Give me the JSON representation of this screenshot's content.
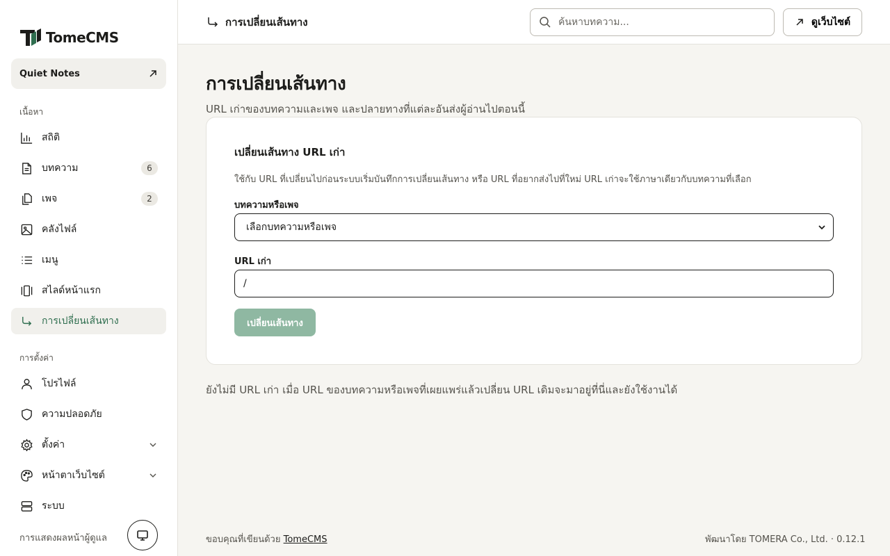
{
  "brand": {
    "name": "TomeCMS",
    "accent": "#2f6e4f",
    "button_disabled": "#8fb8a2"
  },
  "site": {
    "name": "Quiet Notes"
  },
  "sidebar": {
    "content_label": "เนื้อหา",
    "items": [
      {
        "label": "สถิติ",
        "icon": "bar-chart-icon"
      },
      {
        "label": "บทความ",
        "icon": "document-icon",
        "count": "6"
      },
      {
        "label": "เพจ",
        "icon": "pages-icon",
        "count": "2"
      },
      {
        "label": "คลังไฟล์",
        "icon": "image-icon"
      },
      {
        "label": "เมนู",
        "icon": "list-icon"
      },
      {
        "label": "สไลด์หน้าแรก",
        "icon": "slides-icon"
      },
      {
        "label": "การเปลี่ยนเส้นทาง",
        "icon": "redirect-icon",
        "active": true
      }
    ],
    "settings_label": "การตั้งค่า",
    "settings_items": [
      {
        "label": "โปรไฟล์",
        "icon": "user-icon"
      },
      {
        "label": "ความปลอดภัย",
        "icon": "shield-icon"
      },
      {
        "label": "ตั้งค่า",
        "icon": "gear-icon",
        "expandable": true
      },
      {
        "label": "หน้าตาเว็บไซต์",
        "icon": "palette-icon",
        "expandable": true
      },
      {
        "label": "ระบบ",
        "icon": "server-icon"
      }
    ],
    "admin_view_label": "การแสดงผลหน้าผู้ดูแล"
  },
  "topbar": {
    "breadcrumb": "การเปลี่ยนเส้นทาง",
    "search_placeholder": "ค้นหาบทความ...",
    "view_site_label": "ดูเว็บไซต์"
  },
  "main": {
    "title": "การเปลี่ยนเส้นทาง",
    "subtitle": "URL เก่าของบทความและเพจ และปลายทางที่แต่ละอันส่งผู้อ่านไปตอนนี้",
    "card": {
      "title": "เปลี่ยนเส้นทาง URL เก่า",
      "description": "ใช้กับ URL ที่เปลี่ยนไปก่อนระบบเริ่มบันทึกการเปลี่ยนเส้นทาง หรือ URL ที่อยากส่งไปที่ใหม่ URL เก่าจะใช้ภาษาเดียวกับบทความที่เลือก",
      "target_label": "บทความหรือเพจ",
      "target_selected": "เลือกบทความหรือเพจ",
      "old_url_label": "URL เก่า",
      "old_url_value": "/",
      "submit_label": "เปลี่ยนเส้นทาง"
    },
    "empty_note": "ยังไม่มี URL เก่า เมื่อ URL ของบทความหรือเพจที่เผยแพร่แล้วเปลี่ยน URL เดิมจะมาอยู่ที่นี่และยังใช้งานได้"
  },
  "footer": {
    "thanks_prefix": "ขอบคุณที่เขียนด้วย",
    "thanks_link": "TomeCMS",
    "developer": "พัฒนาโดย TOMERA Co., Ltd. · 0.12.1"
  }
}
